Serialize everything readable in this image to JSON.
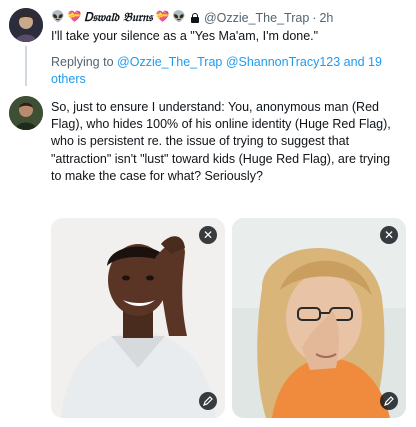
{
  "tweet1": {
    "author_name": "Ꭰ𝔰𝔴𝔞𝔩𝔡 𝔅𝔲𝔯𝔫𝔰",
    "handle": "@Ozzie_The_Trap",
    "separator": "·",
    "time": "2h",
    "text": "I'll take your silence as a \"Yes Ma'am, I'm done.\""
  },
  "reply_context": {
    "prefix": "Replying to",
    "mentions": "@Ozzie_The_Trap @ShannonTracy123 and 19 others"
  },
  "tweet2": {
    "text": "So, just to ensure I understand: You, anonymous man (Red Flag), who hides 100% of his online identity (Huge Red Flag), who is persistent re. the issue of trying to suggest that \"attraction\" isn't \"lust\" toward kids (Huge Red Flag), are trying to make the case for what? Seriously?"
  },
  "media": {
    "remove_glyph": "✕"
  },
  "colors": {
    "link": "#1d9bf0",
    "secondary_text": "#536471",
    "primary_text": "#0f1419"
  }
}
